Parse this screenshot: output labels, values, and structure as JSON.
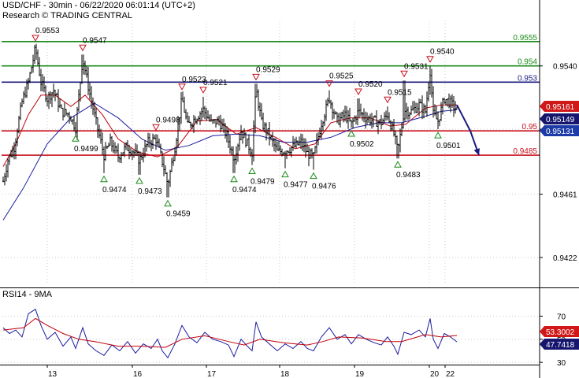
{
  "header": {
    "line1": "USD/CHF - 30min - 06/22/2020 06:01:14 (UTC+2)",
    "line2": "Research © TRADING CENTRAL"
  },
  "rsi_panel": {
    "label": "RSI14 - 9MA"
  },
  "colors": {
    "candle": "#000000",
    "ma_fast": "#c0000a",
    "ma_slow": "#1c1c9e",
    "resistance_green": "#1a8c1a",
    "pivot_navy": "#1a1a80",
    "support_red": "#c8101c",
    "forecast_arrow": "#1a1a80",
    "grid": "#c8c8c8",
    "rsi_line": "#1c1c9e",
    "rsi_ma": "#c0000a",
    "badge_red": "#d01818",
    "badge_navy": "#16166e",
    "badge_blue": "#1c3aa8"
  },
  "chart_data": [
    {
      "type": "line",
      "subtype": "candlestick",
      "title": "USD/CHF - 30min - 06/22/2020 06:01:14 (UTC+2)",
      "x_tick_labels": [
        "13",
        "16",
        "17",
        "18",
        "19",
        "20",
        "22"
      ],
      "y_ticks": [
        0.954,
        0.9501,
        0.9461,
        0.9422
      ],
      "y_tick_labels": [
        "0.9540",
        "0.9501",
        "0.9461",
        "0.9422"
      ],
      "ylim": [
        0.9405,
        0.9568
      ],
      "grid": true,
      "horizontal_levels": [
        {
          "value": 0.9555,
          "label": "0.9555",
          "role": "resistance"
        },
        {
          "value": 0.954,
          "label": "0.954",
          "role": "resistance"
        },
        {
          "value": 0.953,
          "label": "0.953",
          "role": "pivot"
        },
        {
          "value": 0.95,
          "label": "0.95",
          "role": "support"
        },
        {
          "value": 0.9485,
          "label": "0.9485",
          "role": "support"
        }
      ],
      "current_values": [
        {
          "label": "0.95161",
          "role": "ma_fast"
        },
        {
          "label": "0.95149",
          "role": "price"
        },
        {
          "label": "0.95131",
          "role": "ma_slow"
        }
      ],
      "annotations": [
        {
          "label": "0.9553",
          "value": 0.9553,
          "kind": "high",
          "bar": 45
        },
        {
          "label": "0.9547",
          "value": 0.9547,
          "kind": "high",
          "bar": 105
        },
        {
          "label": "0.9499",
          "value": 0.9499,
          "kind": "low",
          "bar": 96
        },
        {
          "label": "0.9474",
          "value": 0.9474,
          "kind": "low",
          "bar": 132
        },
        {
          "label": "0.9473",
          "value": 0.9473,
          "kind": "low",
          "bar": 177
        },
        {
          "label": "0.9498",
          "value": 0.9498,
          "kind": "high",
          "bar": 198
        },
        {
          "label": "0.9459",
          "value": 0.9459,
          "kind": "low",
          "bar": 213
        },
        {
          "label": "0.9523",
          "value": 0.9523,
          "kind": "high",
          "bar": 231
        },
        {
          "label": "0.9521",
          "value": 0.9521,
          "kind": "high",
          "bar": 258
        },
        {
          "label": "0.9474",
          "value": 0.9474,
          "kind": "low",
          "bar": 297
        },
        {
          "label": "0.9479",
          "value": 0.9479,
          "kind": "low",
          "bar": 320
        },
        {
          "label": "0.9529",
          "value": 0.9529,
          "kind": "high",
          "bar": 325
        },
        {
          "label": "0.9477",
          "value": 0.9477,
          "kind": "low",
          "bar": 362
        },
        {
          "label": "0.9476",
          "value": 0.9476,
          "kind": "low",
          "bar": 398
        },
        {
          "label": "0.9525",
          "value": 0.9525,
          "kind": "high",
          "bar": 418
        },
        {
          "label": "0.9502",
          "value": 0.9502,
          "kind": "low",
          "bar": 446
        },
        {
          "label": "0.9520",
          "value": 0.952,
          "kind": "high",
          "bar": 455
        },
        {
          "label": "0.9515",
          "value": 0.9515,
          "kind": "high",
          "bar": 492
        },
        {
          "label": "0.9483",
          "value": 0.9483,
          "kind": "low",
          "bar": 505
        },
        {
          "label": "0.9531",
          "value": 0.9531,
          "kind": "high",
          "bar": 513
        },
        {
          "label": "0.9540",
          "value": 0.954,
          "kind": "high",
          "bar": 546
        },
        {
          "label": "0.9501",
          "value": 0.9501,
          "kind": "low",
          "bar": 556
        }
      ],
      "path_points": [
        [
          4,
          0.9469
        ],
        [
          10,
          0.9482
        ],
        [
          18,
          0.949
        ],
        [
          28,
          0.9518
        ],
        [
          36,
          0.953
        ],
        [
          45,
          0.9551
        ],
        [
          52,
          0.953
        ],
        [
          60,
          0.952
        ],
        [
          68,
          0.9525
        ],
        [
          78,
          0.9512
        ],
        [
          88,
          0.951
        ],
        [
          96,
          0.9502
        ],
        [
          105,
          0.9545
        ],
        [
          113,
          0.9525
        ],
        [
          122,
          0.9505
        ],
        [
          132,
          0.9485
        ],
        [
          140,
          0.9493
        ],
        [
          150,
          0.9484
        ],
        [
          160,
          0.949
        ],
        [
          168,
          0.9488
        ],
        [
          177,
          0.9482
        ],
        [
          188,
          0.9493
        ],
        [
          198,
          0.9495
        ],
        [
          205,
          0.9483
        ],
        [
          213,
          0.9467
        ],
        [
          222,
          0.949
        ],
        [
          231,
          0.952
        ],
        [
          238,
          0.9503
        ],
        [
          248,
          0.9508
        ],
        [
          258,
          0.9513
        ],
        [
          268,
          0.9505
        ],
        [
          278,
          0.9506
        ],
        [
          288,
          0.9497
        ],
        [
          297,
          0.9483
        ],
        [
          306,
          0.95
        ],
        [
          314,
          0.9492
        ],
        [
          320,
          0.9487
        ],
        [
          325,
          0.9526
        ],
        [
          332,
          0.9505
        ],
        [
          342,
          0.9497
        ],
        [
          352,
          0.9487
        ],
        [
          362,
          0.9488
        ],
        [
          372,
          0.949
        ],
        [
          382,
          0.9493
        ],
        [
          390,
          0.9486
        ],
        [
          398,
          0.9484
        ],
        [
          408,
          0.9505
        ],
        [
          418,
          0.952
        ],
        [
          428,
          0.9506
        ],
        [
          438,
          0.951
        ],
        [
          446,
          0.9504
        ],
        [
          455,
          0.9512
        ],
        [
          465,
          0.9508
        ],
        [
          475,
          0.9506
        ],
        [
          484,
          0.9505
        ],
        [
          492,
          0.951
        ],
        [
          500,
          0.9498
        ],
        [
          505,
          0.9487
        ],
        [
          513,
          0.9513
        ],
        [
          522,
          0.9512
        ],
        [
          532,
          0.9516
        ],
        [
          540,
          0.9512
        ],
        [
          546,
          0.9537
        ],
        [
          550,
          0.951
        ],
        [
          556,
          0.9506
        ],
        [
          564,
          0.952
        ],
        [
          572,
          0.9517
        ],
        [
          580,
          0.9513
        ]
      ],
      "forecast_path": [
        [
          580,
          0.9516
        ],
        [
          597,
          0.95
        ],
        [
          608,
          0.9485
        ]
      ],
      "series": [
        {
          "name": "price",
          "role": "ma_fast",
          "values": [
            [
              4,
              0.9478
            ],
            [
              20,
              0.9492
            ],
            [
              36,
              0.951
            ],
            [
              52,
              0.9522
            ],
            [
              70,
              0.9522
            ],
            [
              90,
              0.9515
            ],
            [
              108,
              0.9522
            ],
            [
              130,
              0.951
            ],
            [
              150,
              0.9495
            ],
            [
              175,
              0.9487
            ],
            [
              200,
              0.9484
            ],
            [
              225,
              0.949
            ],
            [
              250,
              0.9506
            ],
            [
              275,
              0.9507
            ],
            [
              300,
              0.9498
            ],
            [
              325,
              0.9502
            ],
            [
              350,
              0.9496
            ],
            [
              375,
              0.9489
            ],
            [
              400,
              0.9492
            ],
            [
              420,
              0.9505
            ],
            [
              445,
              0.9508
            ],
            [
              470,
              0.9508
            ],
            [
              495,
              0.9503
            ],
            [
              515,
              0.9504
            ],
            [
              540,
              0.9514
            ],
            [
              560,
              0.9516
            ],
            [
              580,
              0.9516
            ]
          ]
        },
        {
          "name": "price",
          "role": "ma_slow",
          "values": [
            [
              4,
              0.9445
            ],
            [
              30,
              0.9465
            ],
            [
              60,
              0.9492
            ],
            [
              90,
              0.9508
            ],
            [
              120,
              0.9517
            ],
            [
              150,
              0.9508
            ],
            [
              180,
              0.9495
            ],
            [
              210,
              0.9488
            ],
            [
              240,
              0.9491
            ],
            [
              270,
              0.9497
            ],
            [
              300,
              0.9498
            ],
            [
              330,
              0.9497
            ],
            [
              360,
              0.9493
            ],
            [
              390,
              0.9493
            ],
            [
              420,
              0.9496
            ],
            [
              450,
              0.9502
            ],
            [
              480,
              0.9505
            ],
            [
              510,
              0.9505
            ],
            [
              540,
              0.9509
            ],
            [
              560,
              0.9512
            ],
            [
              580,
              0.9513
            ]
          ]
        }
      ]
    },
    {
      "type": "line",
      "title": "RSI14 - 9MA",
      "y_ticks": [
        70,
        50,
        30
      ],
      "y_tick_labels": [
        "70",
        "50",
        "30"
      ],
      "ylim": [
        26,
        86
      ],
      "grid": true,
      "current_values": [
        {
          "label": "53.3002",
          "role": "rsi_ma"
        },
        {
          "label": "47.7418",
          "role": "rsi"
        }
      ],
      "series": [
        {
          "name": "RSI14",
          "role": "rsi",
          "values": [
            [
              4,
              60
            ],
            [
              12,
              55
            ],
            [
              20,
              58
            ],
            [
              28,
              52
            ],
            [
              36,
              72
            ],
            [
              45,
              76
            ],
            [
              52,
              62
            ],
            [
              60,
              50
            ],
            [
              70,
              56
            ],
            [
              80,
              44
            ],
            [
              90,
              52
            ],
            [
              96,
              42
            ],
            [
              105,
              60
            ],
            [
              112,
              46
            ],
            [
              122,
              40
            ],
            [
              132,
              36
            ],
            [
              142,
              45
            ],
            [
              152,
              40
            ],
            [
              162,
              48
            ],
            [
              172,
              38
            ],
            [
              182,
              46
            ],
            [
              192,
              42
            ],
            [
              200,
              50
            ],
            [
              206,
              40
            ],
            [
              213,
              34
            ],
            [
              222,
              46
            ],
            [
              231,
              62
            ],
            [
              240,
              52
            ],
            [
              250,
              47
            ],
            [
              260,
              56
            ],
            [
              270,
              50
            ],
            [
              280,
              48
            ],
            [
              290,
              45
            ],
            [
              297,
              35
            ],
            [
              306,
              50
            ],
            [
              314,
              44
            ],
            [
              320,
              40
            ],
            [
              325,
              65
            ],
            [
              332,
              52
            ],
            [
              342,
              46
            ],
            [
              352,
              40
            ],
            [
              362,
              46
            ],
            [
              372,
              42
            ],
            [
              382,
              48
            ],
            [
              390,
              42
            ],
            [
              398,
              40
            ],
            [
              408,
              52
            ],
            [
              418,
              60
            ],
            [
              428,
              50
            ],
            [
              438,
              54
            ],
            [
              446,
              46
            ],
            [
              455,
              54
            ],
            [
              465,
              50
            ],
            [
              475,
              47
            ],
            [
              484,
              45
            ],
            [
              492,
              52
            ],
            [
              500,
              44
            ],
            [
              505,
              37
            ],
            [
              513,
              56
            ],
            [
              522,
              54
            ],
            [
              532,
              58
            ],
            [
              540,
              52
            ],
            [
              546,
              68
            ],
            [
              550,
              50
            ],
            [
              556,
              42
            ],
            [
              564,
              55
            ],
            [
              572,
              52
            ],
            [
              580,
              47.7418
            ]
          ]
        },
        {
          "name": "9MA",
          "role": "rsi_ma",
          "values": [
            [
              4,
              58
            ],
            [
              30,
              60
            ],
            [
              45,
              68
            ],
            [
              60,
              62
            ],
            [
              80,
              55
            ],
            [
              100,
              50
            ],
            [
              120,
              48
            ],
            [
              150,
              44
            ],
            [
              180,
              44
            ],
            [
              210,
              43
            ],
            [
              231,
              50
            ],
            [
              260,
              53
            ],
            [
              290,
              48
            ],
            [
              310,
              45
            ],
            [
              330,
              50
            ],
            [
              360,
              47
            ],
            [
              390,
              45
            ],
            [
              410,
              48
            ],
            [
              430,
              52
            ],
            [
              460,
              51
            ],
            [
              490,
              48
            ],
            [
              510,
              48
            ],
            [
              540,
              54
            ],
            [
              560,
              52
            ],
            [
              580,
              53.3002
            ]
          ]
        }
      ]
    }
  ]
}
